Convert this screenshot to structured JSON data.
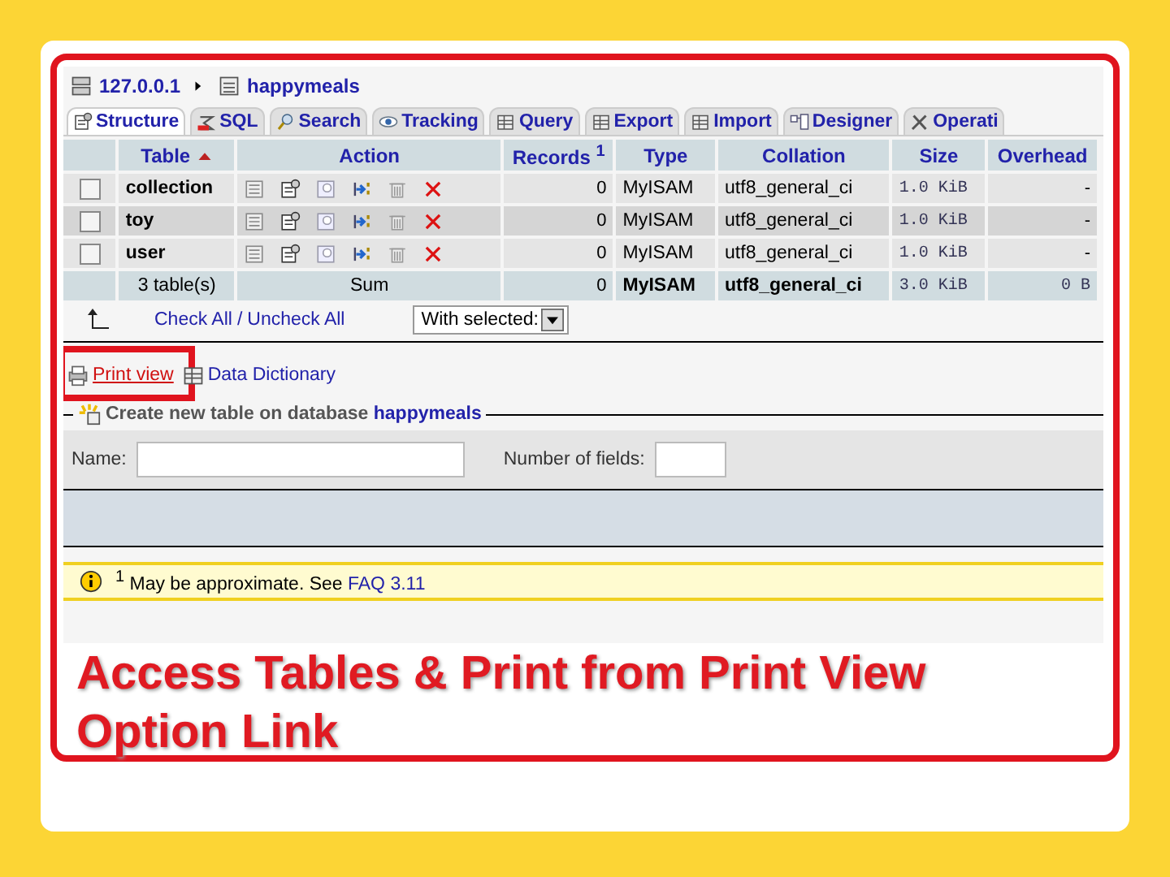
{
  "breadcrumb": {
    "server": "127.0.0.1",
    "database": "happymeals"
  },
  "tabs": [
    {
      "label": "Structure",
      "selected": true
    },
    {
      "label": "SQL",
      "selected": false
    },
    {
      "label": "Search",
      "selected": false
    },
    {
      "label": "Tracking",
      "selected": false
    },
    {
      "label": "Query",
      "selected": false
    },
    {
      "label": "Export",
      "selected": false
    },
    {
      "label": "Import",
      "selected": false
    },
    {
      "label": "Designer",
      "selected": false
    },
    {
      "label": "Operati",
      "selected": false
    }
  ],
  "table": {
    "columns": [
      {
        "label": "Table",
        "sort_ascending": true
      },
      {
        "label": "Action",
        "sort_ascending": false
      },
      {
        "label": "Records $^{1}$",
        "sort_ascending": false
      },
      {
        "label": "Type",
        "sort_ascending": false
      },
      {
        "label": "Collation",
        "sort_ascending": false
      },
      {
        "label": "Size",
        "sort_ascending": false
      },
      {
        "label": "Overhead",
        "sort_ascending": false
      }
    ],
    "rows": [
      {
        "checked": false,
        "name": "collection",
        "records": "0",
        "type": "MyISAM",
        "collation": "utf8_general_ci",
        "size": "1.0 KiB",
        "overhead": "-"
      },
      {
        "checked": false,
        "name": "toy",
        "records": "0",
        "type": "MyISAM",
        "collation": "utf8_general_ci",
        "size": "1.0 KiB",
        "overhead": "-"
      },
      {
        "checked": false,
        "name": "user",
        "records": "0",
        "type": "MyISAM",
        "collation": "utf8_general_ci",
        "size": "1.0 KiB",
        "overhead": "-"
      }
    ],
    "footer": {
      "count": "3 table(s)",
      "action": "Sum",
      "records": "0",
      "type": "MyISAM",
      "collation": "utf8_general_ci",
      "size": "3.0 KiB",
      "overhead": "0 B"
    }
  },
  "selection": {
    "check_all": "Check All",
    "separator": "/",
    "uncheck_all": "Uncheck All",
    "with_selected": "With selected:"
  },
  "links": [
    {
      "label": "Print view",
      "highlighted": true
    },
    {
      "label": "Data Dictionary",
      "highlighted": false
    }
  ],
  "create_table": {
    "legend": "Create new table on database **happymeals**",
    "name_label": "Name:",
    "fields_label": "Number of fields:"
  },
  "note": {
    "text": "$^{1}$ May be approximate. See ",
    "link": "FAQ 3.11"
  },
  "slide_title": "Access Tables & Print from Print View Option Link"
}
